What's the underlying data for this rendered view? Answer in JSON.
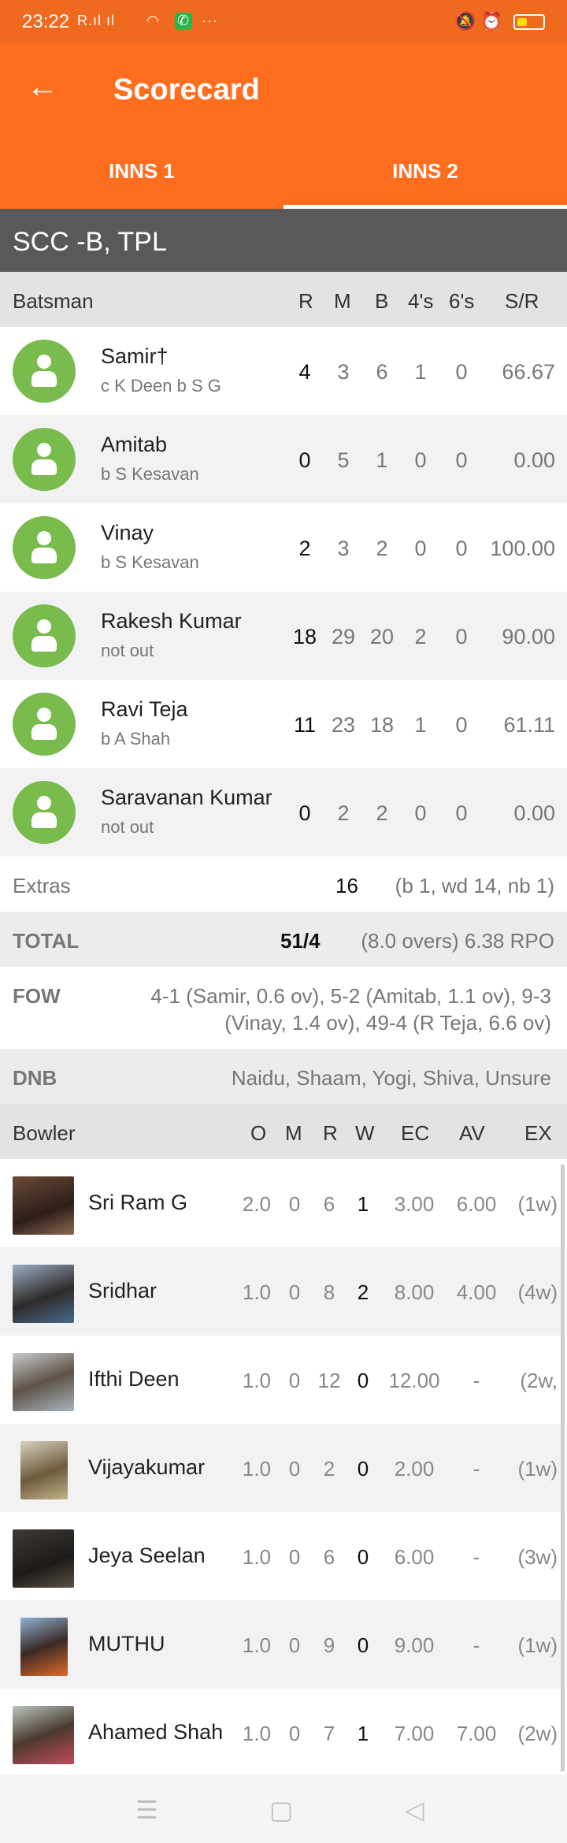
{
  "status": {
    "time": "23:22",
    "signal": "R.ıl ıl",
    "right_icons": "🔕 ⏰"
  },
  "appbar": {
    "title": "Scorecard"
  },
  "tabs": [
    {
      "label": "INNS 1"
    },
    {
      "label": "INNS 2"
    }
  ],
  "team": "SCC -B, TPL",
  "batting_header": {
    "title": "Batsman",
    "cols": [
      "R",
      "M",
      "B",
      "4's",
      "6's",
      "S/R"
    ]
  },
  "batsmen": [
    {
      "name": "Samir†",
      "dismissal": "c K Deen b S G",
      "r": "4",
      "m": "3",
      "b": "6",
      "fours": "1",
      "sixes": "0",
      "sr": "66.67"
    },
    {
      "name": "Amitab",
      "dismissal": "b S Kesavan",
      "r": "0",
      "m": "5",
      "b": "1",
      "fours": "0",
      "sixes": "0",
      "sr": "0.00"
    },
    {
      "name": "Vinay",
      "dismissal": "b S Kesavan",
      "r": "2",
      "m": "3",
      "b": "2",
      "fours": "0",
      "sixes": "0",
      "sr": "100.00"
    },
    {
      "name": "Rakesh Kumar",
      "dismissal": "not out",
      "r": "18",
      "m": "29",
      "b": "20",
      "fours": "2",
      "sixes": "0",
      "sr": "90.00"
    },
    {
      "name": "Ravi Teja",
      "dismissal": "b A Shah",
      "r": "11",
      "m": "23",
      "b": "18",
      "fours": "1",
      "sixes": "0",
      "sr": "61.11"
    },
    {
      "name": "Saravanan Kumar",
      "dismissal": "not out",
      "r": "0",
      "m": "2",
      "b": "2",
      "fours": "0",
      "sixes": "0",
      "sr": "0.00"
    }
  ],
  "extras": {
    "label": "Extras",
    "value": "16",
    "detail": "(b 1, wd 14, nb 1)"
  },
  "total": {
    "label": "TOTAL",
    "value": "51/4",
    "detail": "(8.0 overs) 6.38 RPO"
  },
  "fow": {
    "label": "FOW",
    "line1": "4-1 (Samir, 0.6 ov), 5-2 (Amitab, 1.1 ov), 9-3",
    "line2": "(Vinay, 1.4 ov), 49-4 (R Teja, 6.6 ov)"
  },
  "dnb": {
    "label": "DNB",
    "value": "Naidu, Shaam, Yogi, Shiva, Unsure"
  },
  "bowling_header": {
    "title": "Bowler",
    "cols": [
      "O",
      "M",
      "R",
      "W",
      "EC",
      "AV",
      "EX"
    ]
  },
  "bowlers": [
    {
      "name": "Sri Ram G",
      "o": "2.0",
      "m": "0",
      "r": "6",
      "w": "1",
      "ec": "3.00",
      "av": "6.00",
      "ex": "(1w)"
    },
    {
      "name": "Sridhar",
      "o": "1.0",
      "m": "0",
      "r": "8",
      "w": "2",
      "ec": "8.00",
      "av": "4.00",
      "ex": "(4w)"
    },
    {
      "name": "Ifthi Deen",
      "o": "1.0",
      "m": "0",
      "r": "12",
      "w": "0",
      "ec": "12.00",
      "av": "-",
      "ex": "(2w,"
    },
    {
      "name": "Vijayakumar",
      "o": "1.0",
      "m": "0",
      "r": "2",
      "w": "0",
      "ec": "2.00",
      "av": "-",
      "ex": "(1w)"
    },
    {
      "name": "Jeya Seelan",
      "o": "1.0",
      "m": "0",
      "r": "6",
      "w": "0",
      "ec": "6.00",
      "av": "-",
      "ex": "(3w)"
    },
    {
      "name": "MUTHU",
      "o": "1.0",
      "m": "0",
      "r": "9",
      "w": "0",
      "ec": "9.00",
      "av": "-",
      "ex": "(1w)"
    },
    {
      "name": "Ahamed Shah",
      "o": "1.0",
      "m": "0",
      "r": "7",
      "w": "1",
      "ec": "7.00",
      "av": "7.00",
      "ex": "(2w)"
    }
  ],
  "colors": {
    "accent": "#ff6d1f",
    "team_bar": "#595959",
    "avatar": "#79bb4d"
  },
  "icons": {
    "back": "arrow-left-icon",
    "avatar": "person-icon"
  }
}
